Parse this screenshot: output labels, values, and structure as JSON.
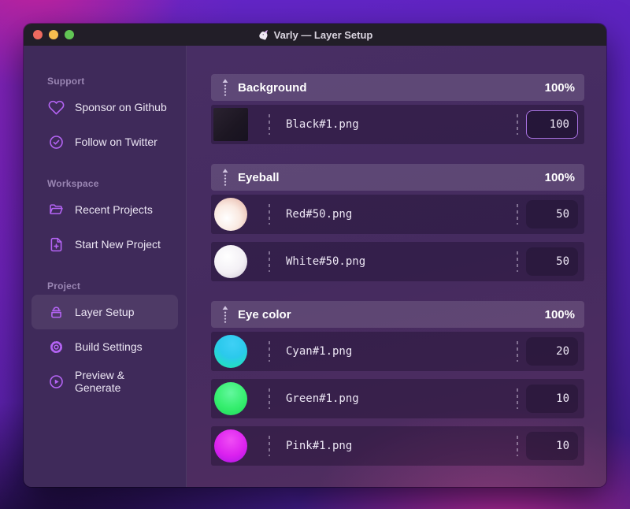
{
  "window": {
    "title": "Varly — Layer Setup"
  },
  "colors": {
    "accent_purple": "#b564f5",
    "focus_border": "#a973e2",
    "sidebar_bg": "#3f2a5a",
    "titlebar_bg": "#221e28",
    "traffic_red": "#ee6a5f",
    "traffic_yellow": "#f5bd4f",
    "traffic_green": "#61c554"
  },
  "sidebar": {
    "sections": [
      {
        "label": "Support",
        "items": [
          {
            "label": "Sponsor on Github",
            "icon": "heart-icon"
          },
          {
            "label": "Follow on Twitter",
            "icon": "badge-check-icon"
          }
        ]
      },
      {
        "label": "Workspace",
        "items": [
          {
            "label": "Recent Projects",
            "icon": "folder-icon"
          },
          {
            "label": "Start New Project",
            "icon": "file-plus-icon"
          }
        ]
      },
      {
        "label": "Project",
        "items": [
          {
            "label": "Layer Setup",
            "icon": "layers-icon",
            "active": true
          },
          {
            "label": "Build Settings",
            "icon": "gear-icon"
          },
          {
            "label": "Preview & Generate",
            "icon": "play-circle-icon"
          }
        ]
      }
    ]
  },
  "main": {
    "groups": [
      {
        "name": "Background",
        "opacity": "100%",
        "layers": [
          {
            "file": "Black#1.png",
            "weight": "100",
            "thumb": "black",
            "focused": true
          }
        ]
      },
      {
        "name": "Eyeball",
        "opacity": "100%",
        "layers": [
          {
            "file": "Red#50.png",
            "weight": "50",
            "thumb": "red"
          },
          {
            "file": "White#50.png",
            "weight": "50",
            "thumb": "white"
          }
        ]
      },
      {
        "name": "Eye color",
        "opacity": "100%",
        "layers": [
          {
            "file": "Cyan#1.png",
            "weight": "20",
            "thumb": "cyan"
          },
          {
            "file": "Green#1.png",
            "weight": "10",
            "thumb": "green"
          },
          {
            "file": "Pink#1.png",
            "weight": "10",
            "thumb": "pink"
          }
        ]
      }
    ]
  }
}
